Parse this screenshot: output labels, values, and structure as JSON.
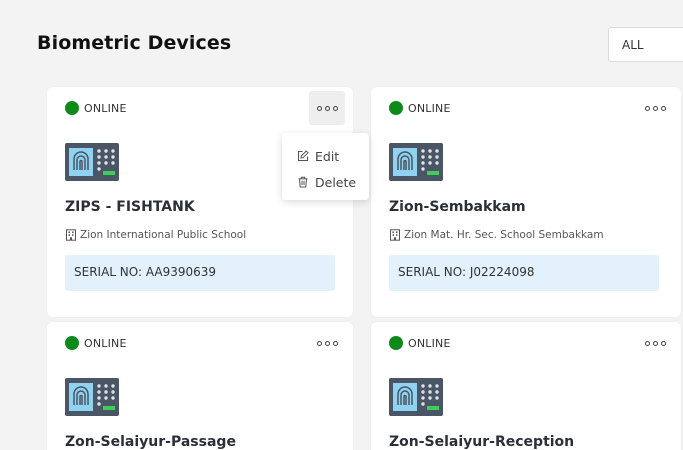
{
  "header": {
    "title": "Biometric Devices",
    "filter_value": "ALL"
  },
  "status_color": "#0e8a1a",
  "devices": [
    {
      "status": "ONLINE",
      "name": "ZIPS - FISHTANK",
      "location": "Zion International Public School",
      "serial": "SERIAL NO: AA9390639"
    },
    {
      "status": "ONLINE",
      "name": "Zion-Sembakkam",
      "location": "Zion Mat. Hr. Sec. School Sembakkam",
      "serial": "SERIAL NO: J02224098"
    },
    {
      "status": "ONLINE",
      "name": "Zon-Selaiyur-Passage"
    },
    {
      "status": "ONLINE",
      "name": "Zon-Selaiyur-Reception"
    }
  ],
  "menu": {
    "edit_label": "Edit",
    "delete_label": "Delete"
  }
}
